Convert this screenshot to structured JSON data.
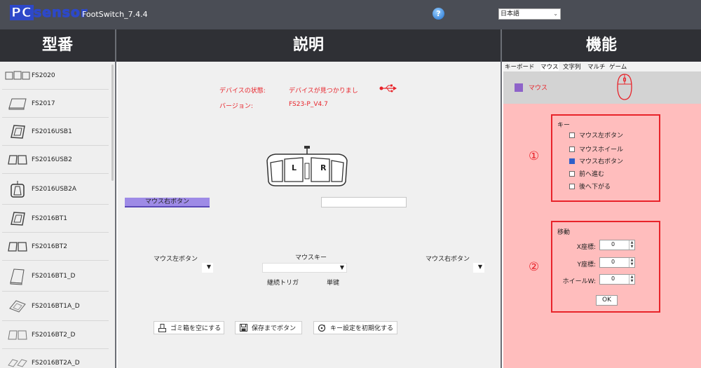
{
  "app": {
    "logo_text": "PCsensor",
    "title": "FootSwitch_7.4.4",
    "language": "日本語"
  },
  "headers": {
    "models": "型番",
    "description": "説明",
    "function": "機能"
  },
  "models": [
    {
      "label": "FS2020"
    },
    {
      "label": "FS2017"
    },
    {
      "label": "FS2016USB1"
    },
    {
      "label": "FS2016USB2"
    },
    {
      "label": "FS2016USB2A"
    },
    {
      "label": "FS2016BT1"
    },
    {
      "label": "FS2016BT2"
    },
    {
      "label": "FS2016BT1_D"
    },
    {
      "label": "FS2016BT1A_D"
    },
    {
      "label": "FS2016BT2_D"
    },
    {
      "label": "FS2016BT2A_D"
    }
  ],
  "device": {
    "status_label": "デバイスの状態:",
    "status_value": "デバイスが見つかりまし",
    "version_label": "バージョン:",
    "version_value": "FS23-P_V4.7"
  },
  "pedal": {
    "left_letter": "L",
    "right_letter": "R"
  },
  "assignment": {
    "current": "マウス右ボタン"
  },
  "pedals_row": {
    "left_label": "マウス左ボタン",
    "center_label": "マウスキー",
    "right_label": "マウス右ボタン",
    "dropdown_arrow": "▼",
    "trigger_continuous": "継続トリガ",
    "trigger_single": "単键"
  },
  "buttons": {
    "empty_trash": "ゴミ箱を空にする",
    "save_button": "保存までボタン",
    "reset_keys": "キー設定を初期化する"
  },
  "tabs": [
    {
      "label": "キーボード",
      "active": false
    },
    {
      "label": "マウス",
      "active": true
    },
    {
      "label": "文字列",
      "active": false
    },
    {
      "label": "マルチ",
      "active": false
    },
    {
      "label": "ゲーム",
      "active": false
    }
  ],
  "mouse_mode": {
    "label": "マウス",
    "swatch_color": "#8e63c9"
  },
  "key_group": {
    "marker": "①",
    "title": "キー",
    "options": [
      {
        "label": "マウス左ボタン",
        "checked": false
      },
      {
        "label": "マウスホイール",
        "checked": false
      },
      {
        "label": "マウス右ボタン",
        "checked": true
      },
      {
        "label": "前へ進む",
        "checked": false
      },
      {
        "label": "後へ下がる",
        "checked": false
      }
    ]
  },
  "move_group": {
    "marker": "②",
    "title": "移動",
    "x_label": "X座標:",
    "x_value": "0",
    "y_label": "Y座標:",
    "y_value": "0",
    "wheel_label": "ホイールW:",
    "wheel_value": "0",
    "ok": "OK"
  },
  "colors": {
    "accent_red": "#e8232a",
    "panel_pink": "#ffbdbd",
    "header_dark": "#2f3035",
    "topbar": "#4a4d55"
  }
}
